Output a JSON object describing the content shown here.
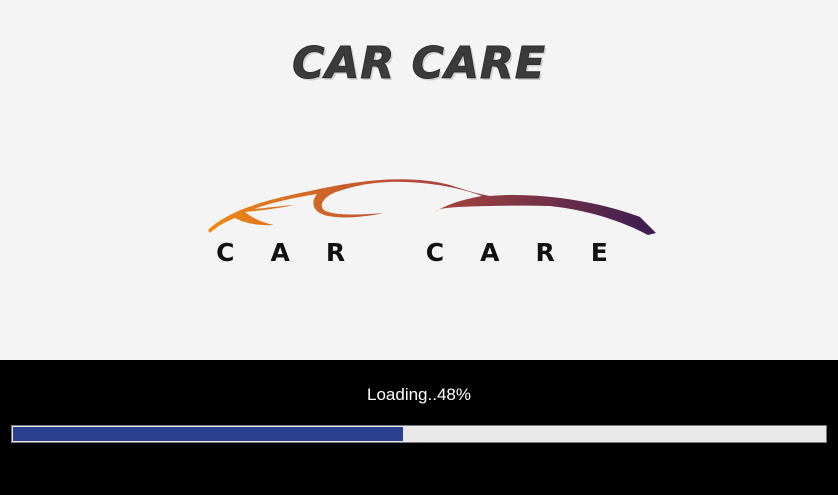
{
  "splash": {
    "title": "CAR CARE",
    "logo_text": "CAR CARE",
    "logo_gradient": [
      "#f08a12",
      "#b54a3a",
      "#3b1c52"
    ]
  },
  "loading": {
    "status_text": "Loading..48%",
    "progress_fraction": 0.48,
    "bar_color": "#2a3f8f",
    "track_color": "#e9e9e9"
  }
}
